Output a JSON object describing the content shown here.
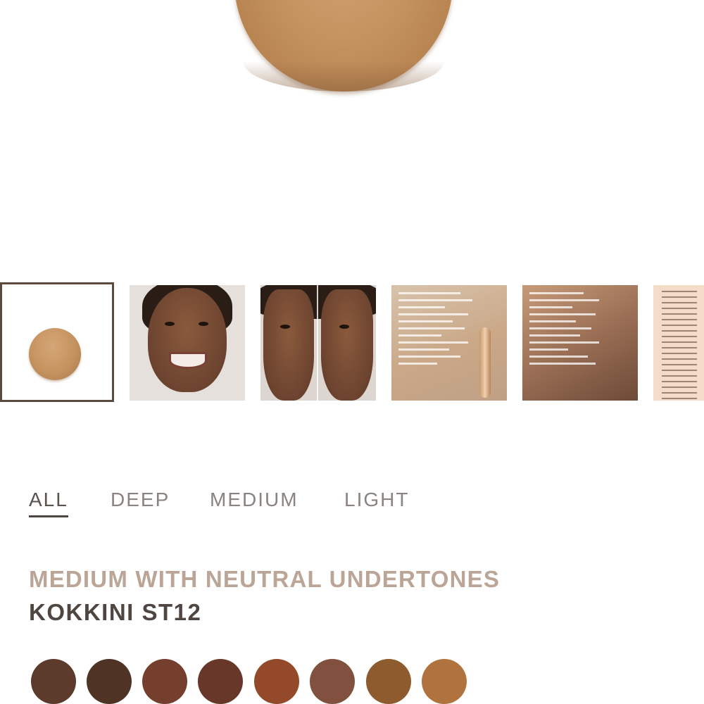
{
  "hero": {
    "swatch_color": "#c4935f"
  },
  "gallery": {
    "thumbnails": [
      {
        "kind": "swatch",
        "selected": true
      },
      {
        "kind": "model-portrait-smiling",
        "selected": false
      },
      {
        "kind": "model-before-after",
        "selected": false
      },
      {
        "kind": "clinical-results-card",
        "selected": false
      },
      {
        "kind": "clinical-results-card",
        "selected": false
      },
      {
        "kind": "shade-list-card",
        "selected": false
      }
    ]
  },
  "filters": {
    "tabs": [
      {
        "label": "ALL",
        "active": true
      },
      {
        "label": "DEEP",
        "active": false
      },
      {
        "label": "MEDIUM",
        "active": false
      },
      {
        "label": "LIGHT",
        "active": false
      }
    ]
  },
  "shade": {
    "family": "MEDIUM WITH NEUTRAL UNDERTONES",
    "name": "KOKKINI ST12"
  },
  "shade_swatches": [
    "#5c3b2c",
    "#4f3426",
    "#74402d",
    "#673829",
    "#93492a",
    "#82503e",
    "#8e5b2e",
    "#b0733f"
  ]
}
